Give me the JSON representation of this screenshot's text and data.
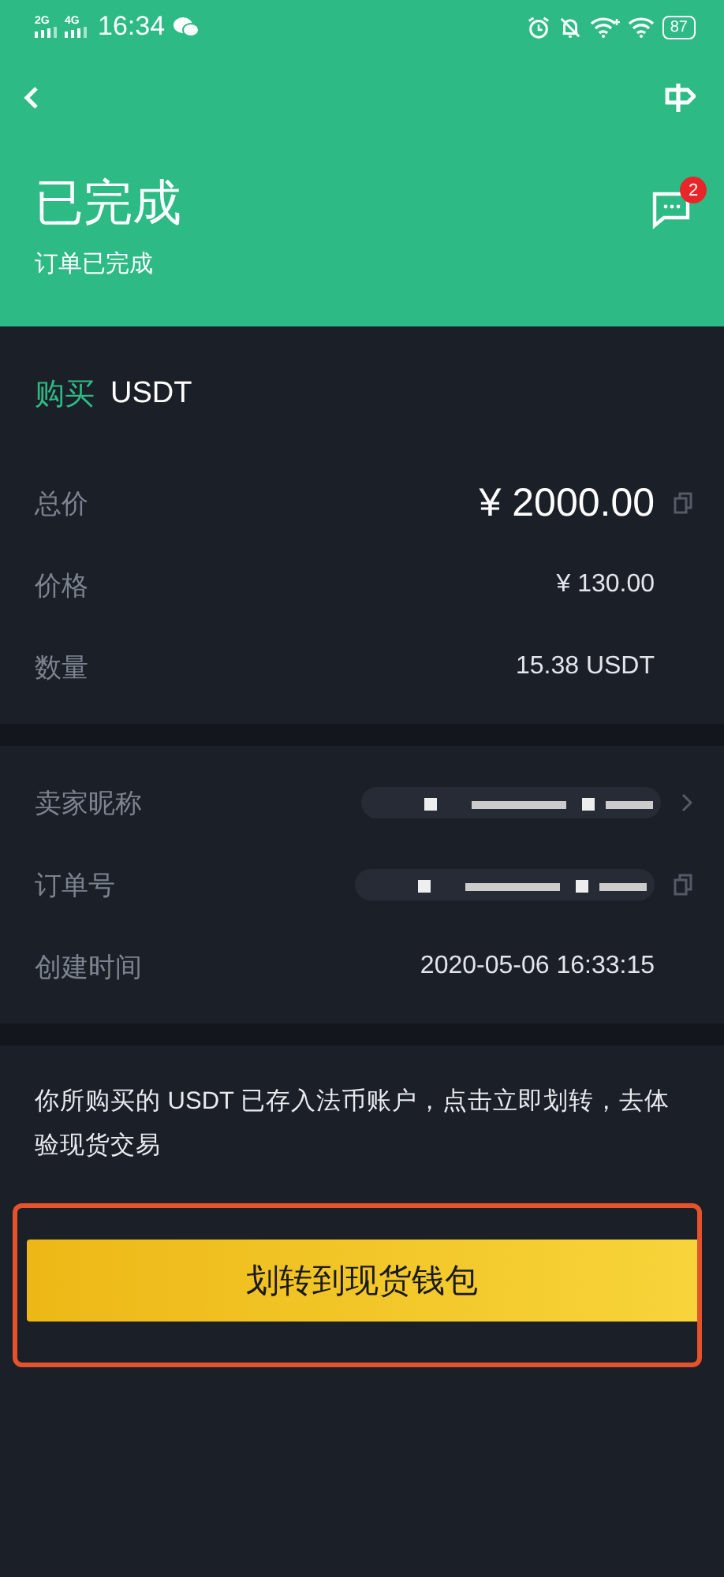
{
  "status_bar": {
    "networks": [
      "2G",
      "4G"
    ],
    "time": "16:34",
    "battery": "87"
  },
  "header": {
    "title": "已完成",
    "subtitle": "订单已完成",
    "chat_badge": "2"
  },
  "order": {
    "side": "购买",
    "asset": "USDT",
    "rows": [
      {
        "label": "总价",
        "value": "¥ 2000.00",
        "kind": "total",
        "copyable": true
      },
      {
        "label": "价格",
        "value": "¥ 130.00",
        "kind": "text"
      },
      {
        "label": "数量",
        "value": "15.38 USDT",
        "kind": "text"
      }
    ]
  },
  "details": {
    "rows": [
      {
        "label": "卖家昵称",
        "kind": "redacted",
        "has_chevron": true
      },
      {
        "label": "订单号",
        "kind": "redacted",
        "copyable": true
      },
      {
        "label": "创建时间",
        "value": "2020-05-06 16:33:15",
        "kind": "text"
      }
    ]
  },
  "notice": "你所购买的 USDT 已存入法币账户，点击立即划转，去体验现货交易",
  "transfer_button": {
    "label": "划转到现货钱包",
    "highlighted": true
  }
}
